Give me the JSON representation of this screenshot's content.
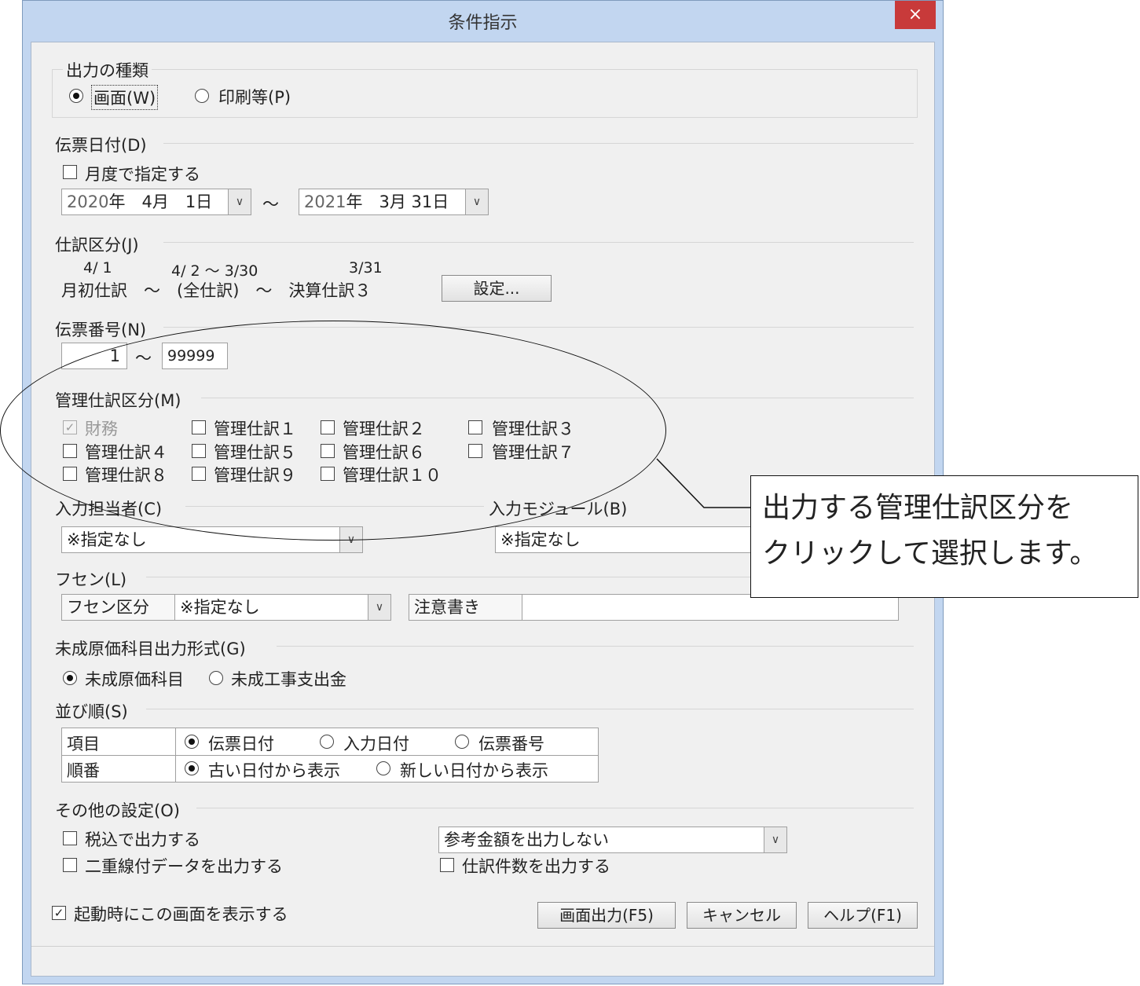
{
  "window": {
    "title": "条件指示",
    "close_label": "×"
  },
  "output_type": {
    "label": "出力の種類",
    "options": [
      {
        "label": "画面(W)",
        "selected": true
      },
      {
        "label": "印刷等(P)",
        "selected": false
      }
    ]
  },
  "date": {
    "label": "伝票日付(D)",
    "monthly_label": "月度で指定する",
    "from_year": "2020",
    "from_rest": "年　4月　1日",
    "to_year": "2021",
    "to_rest": "年　3月 31日",
    "tilde": "～",
    "dropdown_glyph": "∨"
  },
  "journal_class": {
    "label": "仕訳区分(J)",
    "date1": "4/ 1",
    "date2": "4/ 2 ～  3/30",
    "date3": "3/31",
    "range_text": "月初仕訳　～　(全仕訳)　～　決算仕訳３",
    "settings_button": "設定..."
  },
  "voucher_no": {
    "label": "伝票番号(N)",
    "from": "1",
    "to": "99999",
    "tilde": "～"
  },
  "mgmt_class": {
    "label": "管理仕訳区分(M)",
    "items": [
      {
        "label": "財務",
        "checked": true,
        "disabled": true
      },
      {
        "label": "管理仕訳１",
        "checked": false
      },
      {
        "label": "管理仕訳２",
        "checked": false
      },
      {
        "label": "管理仕訳３",
        "checked": false
      },
      {
        "label": "管理仕訳４",
        "checked": false
      },
      {
        "label": "管理仕訳５",
        "checked": false
      },
      {
        "label": "管理仕訳６",
        "checked": false
      },
      {
        "label": "管理仕訳７",
        "checked": false
      },
      {
        "label": "管理仕訳８",
        "checked": false
      },
      {
        "label": "管理仕訳９",
        "checked": false
      },
      {
        "label": "管理仕訳１０",
        "checked": false
      }
    ]
  },
  "input_person": {
    "label": "入力担当者(C)",
    "value": "※指定なし"
  },
  "input_module": {
    "label": "入力モジュール(B)",
    "value": "※指定なし"
  },
  "fusen": {
    "label": "フセン(L)",
    "class_label": "フセン区分",
    "class_value": "※指定なし",
    "note_label": "注意書き",
    "note_value": ""
  },
  "uncompleted": {
    "label": "未成原価科目出力形式(G)",
    "options": [
      {
        "label": "未成原価科目",
        "selected": true
      },
      {
        "label": "未成工事支出金",
        "selected": false
      }
    ]
  },
  "sort": {
    "label": "並び順(S)",
    "item_label": "項目",
    "item_options": [
      {
        "label": "伝票日付",
        "selected": true
      },
      {
        "label": "入力日付",
        "selected": false
      },
      {
        "label": "伝票番号",
        "selected": false
      }
    ],
    "order_label": "順番",
    "order_options": [
      {
        "label": "古い日付から表示",
        "selected": true
      },
      {
        "label": "新しい日付から表示",
        "selected": false
      }
    ]
  },
  "other": {
    "label": "その他の設定(O)",
    "tax_label": "税込で出力する",
    "double_line_label": "二重線付データを出力する",
    "ref_amount_value": "参考金額を出力しない",
    "count_label": "仕訳件数を出力する"
  },
  "footer": {
    "startup_label": "起動時にこの画面を表示する",
    "startup_checked": true,
    "output_button": "画面出力(F5)",
    "cancel_button": "キャンセル",
    "help_button": "ヘルプ(F1)"
  },
  "callout": {
    "line1": "出力する管理仕訳区分を",
    "line2": "クリックして選択します。"
  },
  "colors": {
    "titlebar": "#c2d6f0",
    "close": "#c83a3a",
    "client": "#f0f0f0"
  }
}
